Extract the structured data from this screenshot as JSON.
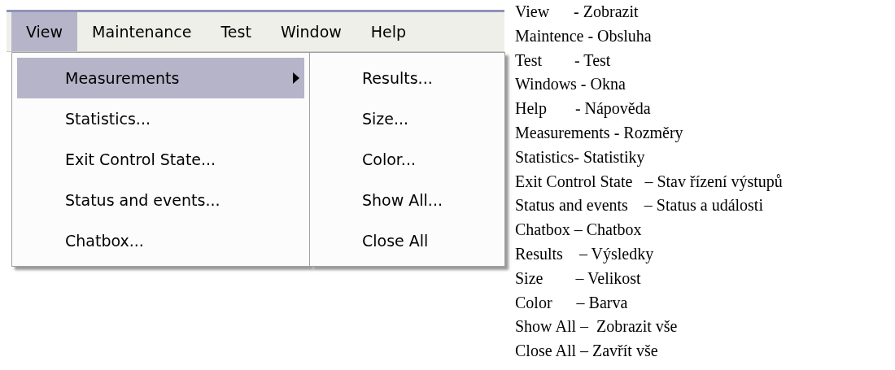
{
  "menu_bar": {
    "items": [
      {
        "label": "View",
        "selected": true
      },
      {
        "label": "Maintenance",
        "selected": false
      },
      {
        "label": "Test",
        "selected": false
      },
      {
        "label": "Window",
        "selected": false
      },
      {
        "label": "Help",
        "selected": false
      }
    ]
  },
  "menu": {
    "items": [
      {
        "label": "Measurements",
        "selected": true,
        "submenu": true
      },
      {
        "label": "Statistics...",
        "selected": false,
        "submenu": false
      },
      {
        "label": "Exit Control State...",
        "selected": false,
        "submenu": false
      },
      {
        "label": "Status and events...",
        "selected": false,
        "submenu": false
      },
      {
        "label": "Chatbox...",
        "selected": false,
        "submenu": false
      }
    ]
  },
  "submenu": {
    "items": [
      {
        "label": "Results..."
      },
      {
        "label": "Size..."
      },
      {
        "label": "Color..."
      },
      {
        "label": "Show All..."
      },
      {
        "label": "Close All"
      }
    ]
  },
  "glossary": [
    "View      - Zobrazit",
    "Maintence - Obsluha",
    "Test        - Test",
    "Windows - Okna",
    "Help       - Nápověda",
    "Measurements - Rozměry",
    "Statistics- Statistiky",
    "Exit Control State   – Stav řízení výstupů",
    "Status and events    – Status a události",
    "Chatbox – Chatbox",
    "Results    – Výsledky",
    "Size        – Velikost",
    "Color      – Barva",
    "Show All –  Zobrazit vše",
    "Close All – Zavřít vše"
  ]
}
